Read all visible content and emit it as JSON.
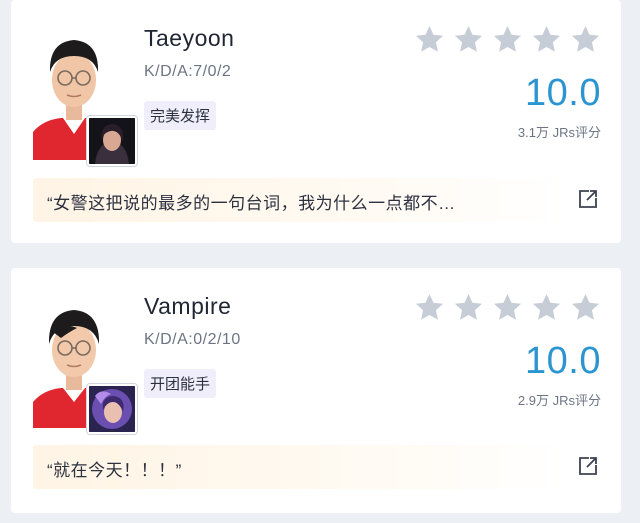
{
  "cards": [
    {
      "player": "Taeyoon",
      "kda": "K/D/A:7/0/2",
      "tag": "完美发挥",
      "stars": [
        {
          "icon": "star-icon"
        },
        {
          "icon": "star-icon"
        },
        {
          "icon": "star-icon"
        },
        {
          "icon": "star-icon"
        },
        {
          "icon": "star-icon"
        }
      ],
      "score": "10.0",
      "rating_count": "3.1万 JRs评分",
      "quote": "“女警这把说的最多的一句台词，我为什么一点都不…",
      "share_icon": "share-icon"
    },
    {
      "player": "Vampire",
      "kda": "K/D/A:0/2/10",
      "tag": "开团能手",
      "stars": [
        {
          "icon": "star-icon"
        },
        {
          "icon": "star-icon"
        },
        {
          "icon": "star-icon"
        },
        {
          "icon": "star-icon"
        },
        {
          "icon": "star-icon"
        }
      ],
      "score": "10.0",
      "rating_count": "2.9万 JRs评分",
      "quote": "“就在今天！！！”",
      "share_icon": "share-icon"
    }
  ],
  "colors": {
    "score": "#2a95d0",
    "star": "#c7cdd7",
    "tag_bg": "#f0eefa",
    "quote_bg": "#fff4e5",
    "page_bg": "#eceff4"
  }
}
